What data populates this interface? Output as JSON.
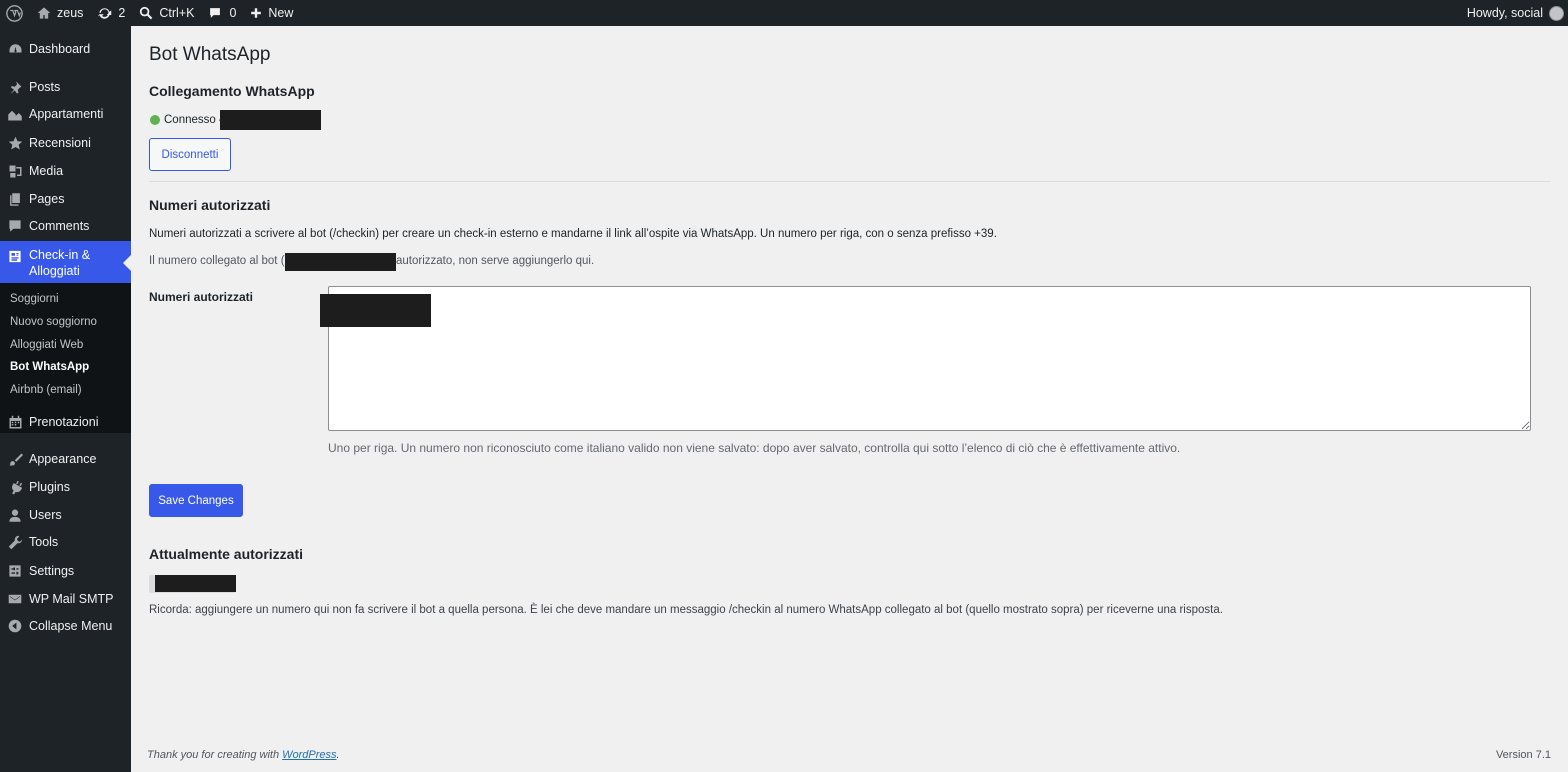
{
  "adminbar": {
    "site_name": "zeus",
    "updates_count": "2",
    "search_shortcut": "Ctrl+K",
    "comments_count": "0",
    "new_label": "New",
    "howdy": "Howdy, social"
  },
  "sidebar": {
    "items": [
      {
        "label": "Dashboard",
        "icon": "dashboard-icon"
      },
      {
        "label": "Posts",
        "icon": "pin-icon"
      },
      {
        "label": "Appartamenti",
        "icon": "buildings-icon"
      },
      {
        "label": "Recensioni",
        "icon": "star-icon"
      },
      {
        "label": "Media",
        "icon": "media-icon"
      },
      {
        "label": "Pages",
        "icon": "pages-icon"
      },
      {
        "label": "Comments",
        "icon": "comment-icon"
      },
      {
        "label": "Check-in &",
        "label2": "Alloggiati",
        "icon": "id-card-icon"
      },
      {
        "label": "Prenotazioni",
        "icon": "calendar-icon"
      },
      {
        "label": "Appearance",
        "icon": "brush-icon"
      },
      {
        "label": "Plugins",
        "icon": "plug-icon"
      },
      {
        "label": "Users",
        "icon": "user-icon"
      },
      {
        "label": "Tools",
        "icon": "wrench-icon"
      },
      {
        "label": "Settings",
        "icon": "settings-icon"
      },
      {
        "label": "WP Mail SMTP",
        "icon": "mail-icon"
      },
      {
        "label": "Collapse Menu",
        "icon": "collapse-icon"
      }
    ],
    "submenu": [
      {
        "label": "Soggiorni"
      },
      {
        "label": "Nuovo soggiorno"
      },
      {
        "label": "Alloggiati Web"
      },
      {
        "label": "Bot WhatsApp"
      },
      {
        "label": "Airbnb (email)"
      }
    ]
  },
  "page": {
    "title": "Bot WhatsApp",
    "connection_heading": "Collegamento WhatsApp",
    "status_text": "Connesso –",
    "disconnect_label": "Disconnetti",
    "authorized_heading": "Numeri autorizzati",
    "description": "Numeri autorizzati a scrivere al bot (/checkin) per creare un check-in esterno e mandarne il link all’ospite via WhatsApp. Un numero per riga, con o senza prefisso +39.",
    "bot_note_prefix": "Il numero collegato al bot (39",
    "bot_note_suffix": "autorizzato, non serve aggiungerlo qui.",
    "field_label": "Numeri autorizzati",
    "field_help": "Uno per riga. Un numero non riconosciuto come italiano valido non viene salvato: dopo aver salvato, controlla qui sotto l’elenco di ciò che è effettivamente attivo.",
    "save_label": "Save Changes",
    "current_heading": "Attualmente autorizzati",
    "reminder": "Ricorda: aggiungere un numero qui non fa scrivere il bot a quella persona. È lei che deve mandare un messaggio /checkin al numero WhatsApp collegato al bot (quello mostrato sopra) per riceverne una risposta."
  },
  "footer": {
    "thanks_prefix": "Thank you for creating with ",
    "thanks_link": "WordPress",
    "thanks_suffix": ".",
    "version": "Version 7.1"
  },
  "colors": {
    "accent": "#3858e9",
    "status_connected": "#5fb152",
    "adminbar_bg": "#1d2327"
  }
}
